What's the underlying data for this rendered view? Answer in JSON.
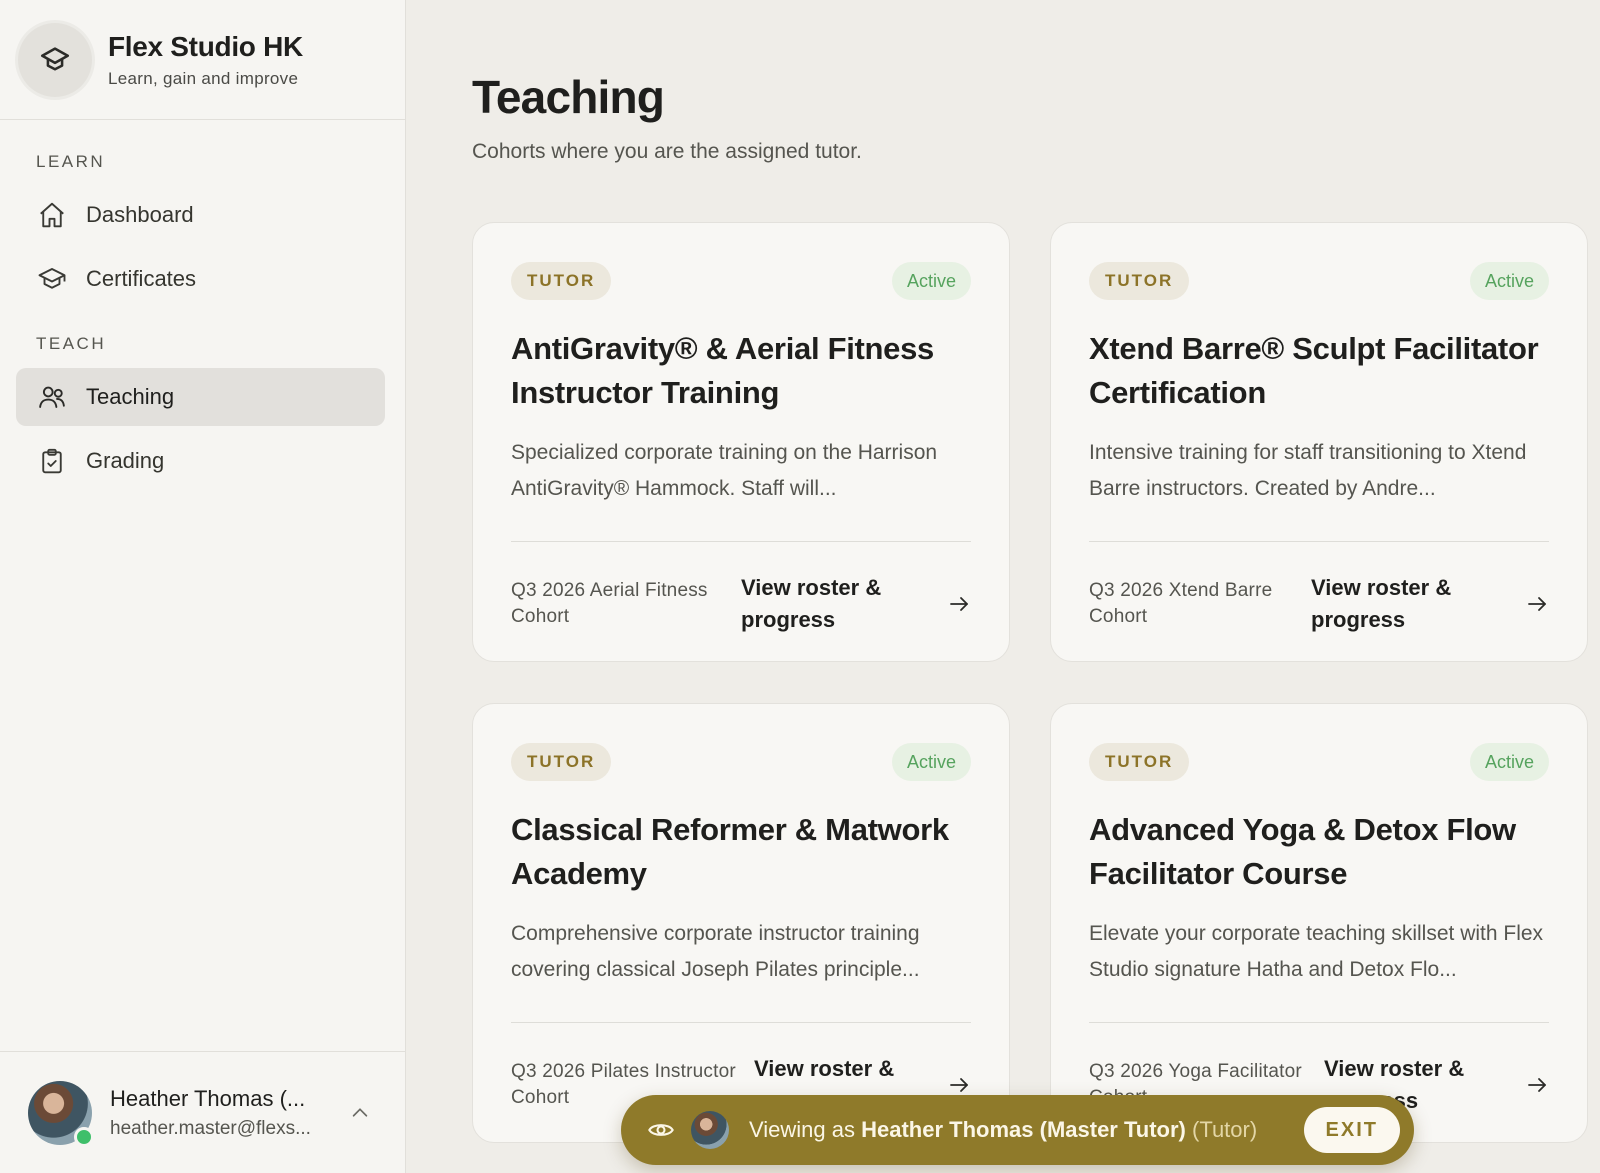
{
  "brand": {
    "name": "Flex Studio HK",
    "tagline": "Learn, gain and improve"
  },
  "nav": {
    "learn_label": "LEARN",
    "learn_items": [
      {
        "label": "Dashboard",
        "icon": "home-icon"
      },
      {
        "label": "Certificates",
        "icon": "graduation-cap-icon"
      }
    ],
    "teach_label": "TEACH",
    "teach_items": [
      {
        "label": "Teaching",
        "icon": "users-icon",
        "active": true
      },
      {
        "label": "Grading",
        "icon": "clipboard-check-icon"
      }
    ]
  },
  "user": {
    "name": "Heather Thomas (...",
    "email": "heather.master@flexs...",
    "status": "online"
  },
  "page": {
    "title": "Teaching",
    "subtitle": "Cohorts where you are the assigned tutor."
  },
  "cards": [
    {
      "role": "TUTOR",
      "status": "Active",
      "title": "AntiGravity® & Aerial Fitness Instructor Training",
      "description": "Specialized corporate training on the Harrison AntiGravity® Hammock. Staff will...",
      "cohort": "Q3 2026 Aerial Fitness Cohort",
      "link": "View roster & progress"
    },
    {
      "role": "TUTOR",
      "status": "Active",
      "title": "Xtend Barre® Sculpt Facilitator Certification",
      "description": "Intensive training for staff transitioning to Xtend Barre instructors. Created by Andre...",
      "cohort": "Q3 2026 Xtend Barre Cohort",
      "link": "View roster & progress"
    },
    {
      "role": "TUTOR",
      "status": "Active",
      "title": "Classical Reformer & Matwork Academy",
      "description": "Comprehensive corporate instructor training covering classical Joseph Pilates principle...",
      "cohort": "Q3 2026 Pilates Instructor Cohort",
      "link": "View roster & progress"
    },
    {
      "role": "TUTOR",
      "status": "Active",
      "title": "Advanced Yoga & Detox Flow Facilitator Course",
      "description": "Elevate your corporate teaching skillset with Flex Studio signature Hatha and Detox Flo...",
      "cohort": "Q3 2026 Yoga Facilitator Cohort",
      "link": "View roster & progress"
    }
  ],
  "viewing_bar": {
    "prefix": "Viewing as",
    "name": "Heather Thomas (Master Tutor)",
    "role": "(Tutor)",
    "exit_label": "EXIT"
  },
  "colors": {
    "accent": "#8f7a2a",
    "active_green": "#56a35e",
    "background": "#efede8"
  }
}
